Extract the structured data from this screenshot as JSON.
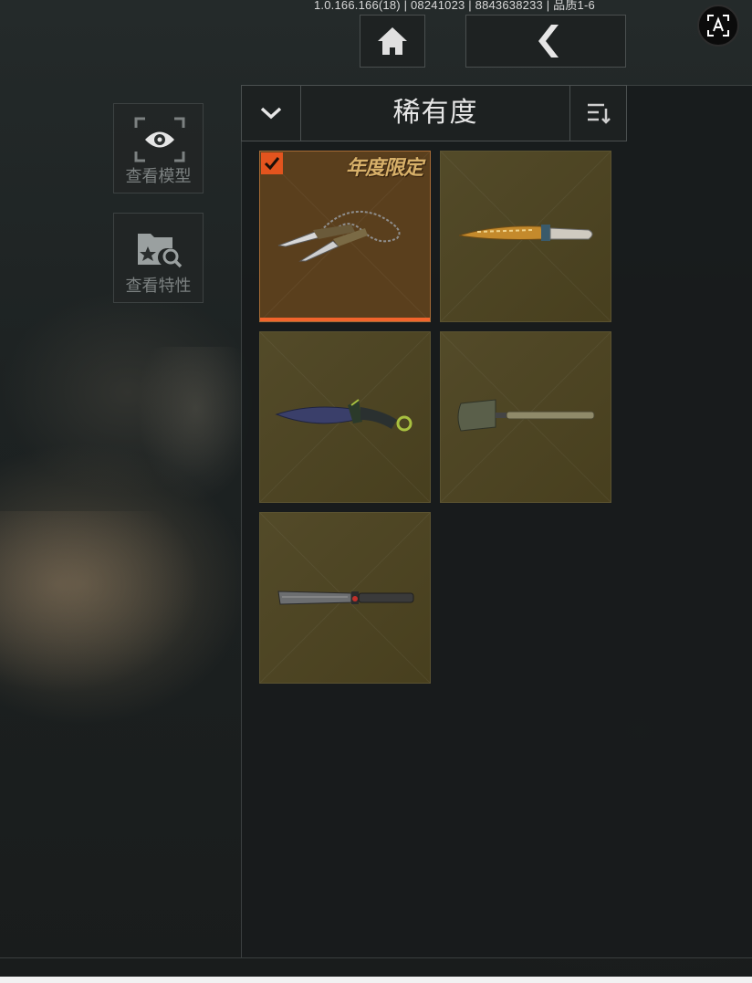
{
  "version_text": "1.0.166.166(18) | 08241023 | 8843638233 | 品质1-6",
  "top_buttons": {
    "home_icon": "home-icon",
    "back_icon": "back-chevron-icon"
  },
  "side_buttons": [
    {
      "label": "查看模型",
      "icon": "eye-icon"
    },
    {
      "label": "查看特性",
      "icon": "feature-search-icon"
    }
  ],
  "filter_bar": {
    "title": "稀有度",
    "dropdown_icon": "chevron-down-icon",
    "sort_icon": "sort-icon"
  },
  "items": [
    {
      "name": "chain-kunai",
      "selected": true,
      "tag": "年度限定",
      "icon": "kunai-icon"
    },
    {
      "name": "golden-knife",
      "selected": false,
      "tag": "",
      "icon": "knife-icon"
    },
    {
      "name": "karambit",
      "selected": false,
      "tag": "",
      "icon": "karambit-icon"
    },
    {
      "name": "shovel",
      "selected": false,
      "tag": "",
      "icon": "shovel-icon"
    },
    {
      "name": "machete",
      "selected": false,
      "tag": "",
      "icon": "machete-icon"
    }
  ],
  "colors": {
    "accent": "#f2642c",
    "cell": "#4c4320",
    "selected_cell": "#5a3f1d"
  }
}
